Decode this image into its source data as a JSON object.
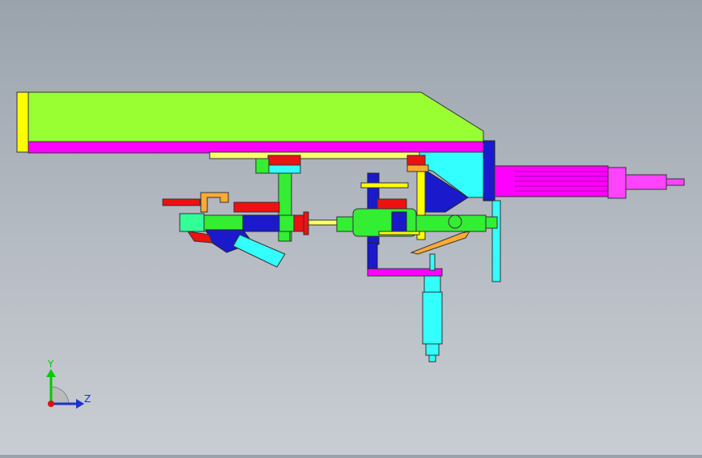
{
  "viewport": {
    "background_top": "#9aa3ad",
    "background_bottom": "#c9cdd3"
  },
  "triad": {
    "y_label": "Y",
    "z_label": "Z",
    "y_color": "#00cc00",
    "z_color": "#1a33cc",
    "origin_color": "#dd1111"
  },
  "palette": {
    "lime": "#99ff33",
    "magenta": "#ff00ff",
    "yellow": "#ffff00",
    "cyan": "#33ffff",
    "blue": "#1a1acc",
    "green": "#33ee33",
    "red": "#ee1111",
    "orange": "#ffaa33",
    "purple": "#cc33cc"
  }
}
